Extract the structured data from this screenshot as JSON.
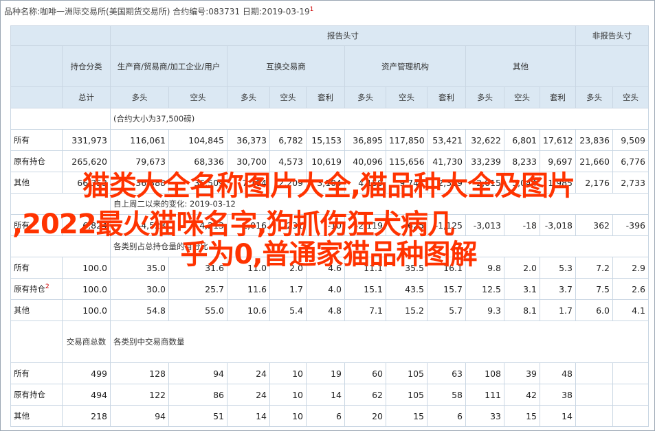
{
  "title_line": "品种名称:咖啡一洲际交易所(美国期货交易所) 合约编号:083731 日期:2019-03-19",
  "title_note": "1",
  "headers": {
    "position_class": "持仓分类",
    "reportable": "报告头寸",
    "non_reportable": "非报告头寸",
    "producer": "生产商/贸易商/加工企业/用户",
    "swap": "互换交易商",
    "managed": "资产管理机构",
    "other": "其他",
    "total": "总计",
    "long": "多头",
    "short": "空头",
    "spread": "套利"
  },
  "contract_note": "(合约大小为37,500磅)",
  "rows_main": [
    {
      "label": "所有",
      "values": [
        "331,973",
        "116,061",
        "104,845",
        "36,373",
        "6,782",
        "15,153",
        "36,895",
        "117,850",
        "53,421",
        "32,622",
        "6,801",
        "17,612",
        "23,836",
        "9,509"
      ]
    },
    {
      "label": "原有持仓",
      "values": [
        "265,620",
        "79,673",
        "68,336",
        "30,700",
        "4,573",
        "10,619",
        "40,096",
        "115,656",
        "41,730",
        "33,239",
        "8,233",
        "9,697",
        "21,660",
        "6,776"
      ]
    },
    {
      "label": "其他",
      "values": [
        "66,353",
        "36,388",
        "36,509",
        "7,104",
        "2,209",
        "3,104",
        "4,150",
        "9,745",
        "2,359",
        "2,015",
        "5,044",
        "1,985",
        "2,176",
        "2,733"
      ]
    }
  ],
  "changes_note": "自上周二以来的变化: 2019-03-12",
  "rows_change": [
    {
      "label": "所有",
      "values": [
        "6,824",
        "-4,523",
        "4,213",
        "1,016",
        "-231",
        "-10",
        "-2,119",
        "625",
        "-1,125",
        "-3,013",
        "-18",
        "-3,018",
        "362",
        "-396"
      ]
    }
  ],
  "pct_note": "各类别占总持仓量的百分比",
  "rows_pct": [
    {
      "label": "所有",
      "values": [
        "100.0",
        "35.0",
        "31.6",
        "11.0",
        "2.0",
        "4.6",
        "11.1",
        "35.5",
        "16.1",
        "9.8",
        "2.0",
        "5.3",
        "7.2",
        "2.9"
      ]
    },
    {
      "label": "原有持仓",
      "note": "2",
      "values": [
        "100.0",
        "30.0",
        "25.7",
        "11.6",
        "1.7",
        "4.0",
        "15.1",
        "43.5",
        "15.7",
        "12.5",
        "3.1",
        "3.7",
        "7.5",
        "2.6"
      ]
    },
    {
      "label": "其他",
      "values": [
        "100.0",
        "54.8",
        "55.0",
        "10.6",
        "5.4",
        "4.8",
        "7.1",
        "15.2",
        "5.7",
        "9.3",
        "8.1",
        "1.7",
        "6.0",
        "4.1"
      ]
    }
  ],
  "trader_header": "交易商总数",
  "trader_note": "各类别中交易商数量",
  "rows_traders": [
    {
      "label": "所有",
      "values": [
        "499",
        "128",
        "94",
        "24",
        "10",
        "19",
        "60",
        "105",
        "63",
        "108",
        "39",
        "48",
        "",
        ""
      ]
    },
    {
      "label": "原有持仓",
      "values": [
        "494",
        "122",
        "86",
        "24",
        "10",
        "14",
        "62",
        "105",
        "58",
        "111",
        "42",
        "38",
        "",
        ""
      ]
    },
    {
      "label": "其他",
      "values": [
        "218",
        "94",
        "51",
        "14",
        "10",
        "6",
        "20",
        "15",
        "6",
        "33",
        "15",
        "14",
        "",
        ""
      ]
    }
  ],
  "overlay": {
    "line1": "猫类大全名称图片大全,猫品种大全及图片",
    "line2": ",2022最火猫咪名字,狗抓伤狂犬病几",
    "line3": "乎为0,普通家猫品种图解"
  },
  "colors": {
    "header_bg": "#dbe8f3",
    "border": "#c9d6e3",
    "overlay": "#ff3300",
    "note": "#cc0000"
  }
}
